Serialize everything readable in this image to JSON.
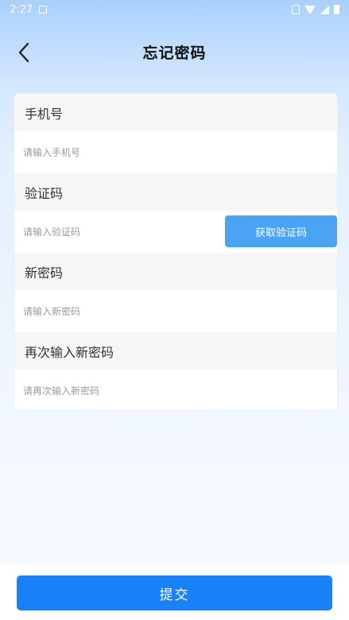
{
  "status_bar": {
    "time": "2:27",
    "icons": [
      "notification-icon",
      "vibrate-icon",
      "wifi-icon",
      "signal-icon",
      "battery-icon"
    ]
  },
  "header": {
    "title": "忘记密码",
    "back_icon": "chevron-left-icon"
  },
  "form": {
    "phone": {
      "label": "手机号",
      "placeholder": "请输入手机号"
    },
    "code": {
      "label": "验证码",
      "placeholder": "请输入验证码",
      "button_label": "获取验证码"
    },
    "new_password": {
      "label": "新密码",
      "placeholder": "请输入新密码"
    },
    "confirm_password": {
      "label": "再次输入新密码",
      "placeholder": "请再次输入新密码"
    }
  },
  "footer": {
    "submit_label": "提交"
  },
  "colors": {
    "primary": "#1a82f8",
    "code_button": "#4aa3f5",
    "header_gradient_top": "#a9d0fb",
    "label_row_bg": "#f6f6f7"
  }
}
